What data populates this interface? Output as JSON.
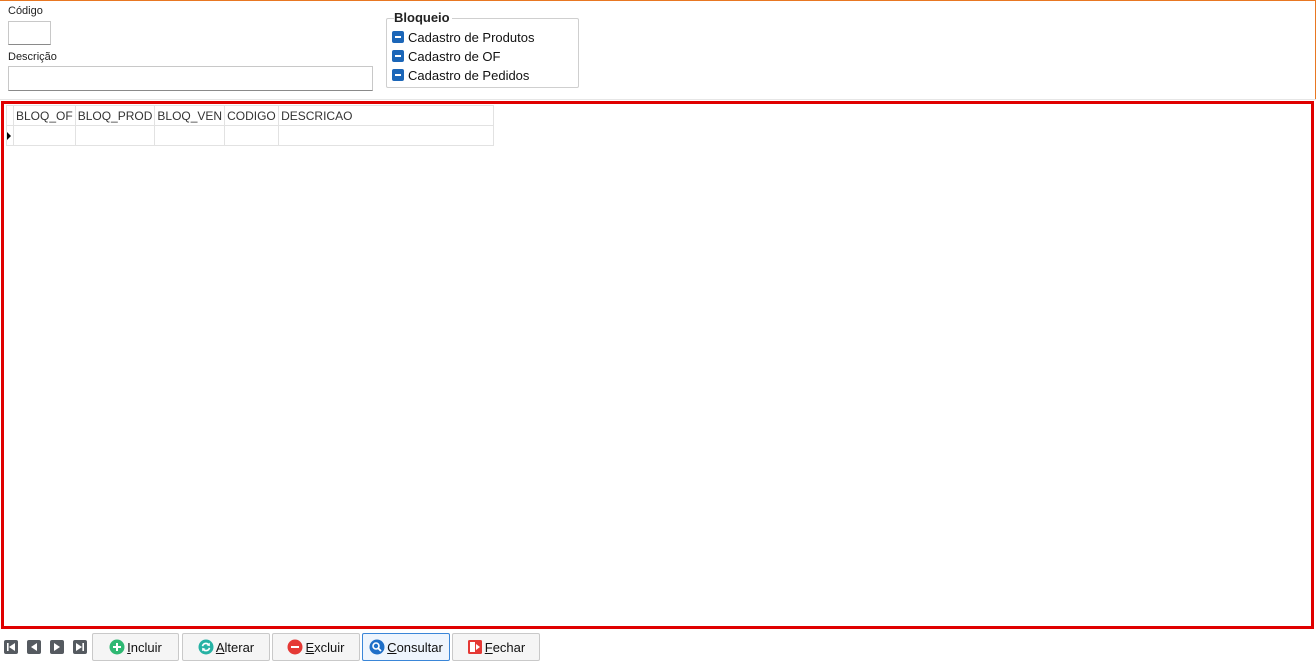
{
  "form": {
    "codigo_label": "Código",
    "codigo_value": "",
    "descricao_label": "Descrição",
    "descricao_value": ""
  },
  "bloqueio": {
    "title": "Bloqueio",
    "items": [
      {
        "label": "Cadastro de Produtos",
        "state": "indeterminate"
      },
      {
        "label": "Cadastro de OF",
        "state": "indeterminate"
      },
      {
        "label": "Cadastro de Pedidos",
        "state": "indeterminate"
      }
    ]
  },
  "grid": {
    "columns": [
      "BLOQ_OF",
      "BLOQ_PROD",
      "BLOQ_VEN",
      "CODIGO",
      "DESCRICAO"
    ],
    "rows": [
      [
        "",
        "",
        "",
        "",
        ""
      ]
    ]
  },
  "navigator": {
    "buttons": [
      "first-icon",
      "prior-icon",
      "next-icon",
      "last-icon"
    ]
  },
  "toolbar": {
    "incluir": {
      "hotkey": "I",
      "rest": "ncluir",
      "icon": "plus-circle-icon"
    },
    "alterar": {
      "hotkey": "A",
      "rest": "lterar",
      "icon": "refresh-icon"
    },
    "excluir": {
      "hotkey": "E",
      "rest": "xcluir",
      "icon": "minus-circle-icon"
    },
    "consultar": {
      "hotkey": "C",
      "rest": "onsultar",
      "icon": "search-icon"
    },
    "fechar": {
      "hotkey": "F",
      "rest": "echar",
      "icon": "exit-icon"
    }
  },
  "colors": {
    "accent": "#e87722",
    "grid_border": "#e00000",
    "checkbox": "#1b66b8",
    "incluir": "#2eb872",
    "alterar": "#26b2a4",
    "excluir": "#e53935",
    "consultar": "#1e6fc8",
    "fechar": "#e53935"
  }
}
